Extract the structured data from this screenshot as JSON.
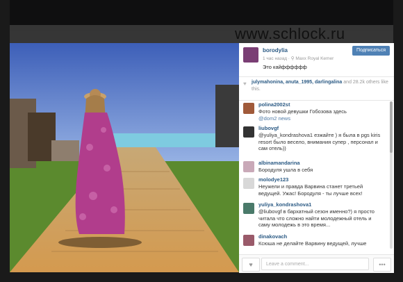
{
  "watermark": "www.schlock.ru",
  "post": {
    "username": "borodylia",
    "follow_label": "Подписаться",
    "time_location": "1 час назад · ⚲ Maxx Royal Kemer",
    "caption": "Это кайфффффф"
  },
  "likes": {
    "names": "julymahonina, anuta_1995, darlingalina",
    "count_text": "and 28.2k others like this."
  },
  "comments": [
    {
      "name": "polina2002st",
      "text": "Фото новой девушки Гобозова здесь",
      "mention": "@dom2 news"
    },
    {
      "name": "liubovgf",
      "text": "@yuliya_kondrashova1 езжайте ) я была в pgs kiris resort было весело, внимания супер , персонал и сам отель))"
    },
    {
      "name": "albinamandarina",
      "text": "Бородуля ушла в себя"
    },
    {
      "name": "molodye123",
      "text": "Неужели и правда Варвина станет третьей ведущей. Ужас! Бородуля - ты лучше всех!"
    },
    {
      "name": "yuliya_kondrashova1",
      "text": "@liubovgf в бархатный сезон именно?) я просто читала что сложно найти молодежный отель и саму молодежь в это время..."
    },
    {
      "name": "dinakovach",
      "text": "Ксюша не делайте Варвину ведущей, лучше"
    }
  ],
  "footer": {
    "comment_placeholder": "Leave a comment...",
    "like_icon": "heart-icon",
    "more_icon": "ellipsis-icon"
  },
  "colors": {
    "accent": "#4f81b5",
    "username": "#2b5a84",
    "dress": "#b13d8c"
  }
}
